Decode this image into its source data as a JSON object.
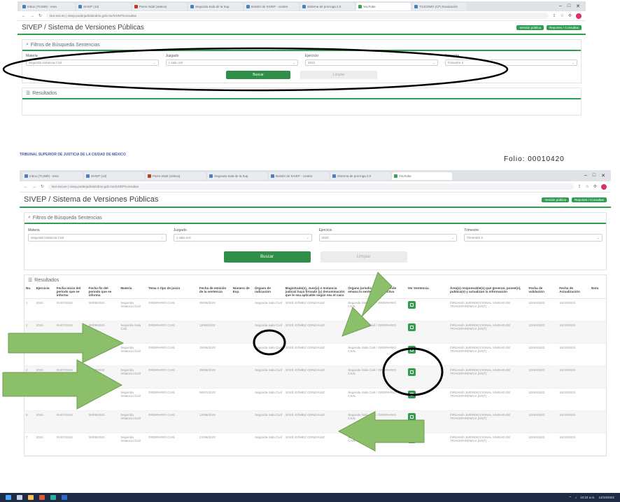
{
  "top_window": {
    "tabs": [
      {
        "label": "Inbox (70,580) - ema",
        "icon": "mail-favicon",
        "active": false
      },
      {
        "label": "SIVEP (13)",
        "icon": "doc-favicon",
        "active": false
      },
      {
        "label": "Parra Vidal (videos)",
        "icon": "youtube-favicon",
        "active": false
      },
      {
        "label": "Segunda Sala de la Sup",
        "icon": "page-favicon",
        "active": false
      },
      {
        "label": "Boletín de SIVEP - conten",
        "icon": "page-favicon",
        "active": false
      },
      {
        "label": "Sistema de prorroga 2.0",
        "icon": "page-favicon",
        "active": false
      },
      {
        "label": "YouTube",
        "icon": "chrome-favicon",
        "active": true
      },
      {
        "label": "TSJCDMX (CP) Evaluación",
        "icon": "page-favicon",
        "active": false
      }
    ],
    "url": "Not secure | sivep.poderjudicialcdmx.gob.mx/SIVEP/consultas",
    "app_title": "SIVEP / Sistema de Versiones Públicas",
    "top_buttons": [
      "Versión pública",
      "Reportes / Consultas"
    ],
    "filters_title": "Filtros de Búsqueda Sentencias",
    "filters": [
      {
        "label": "Materia",
        "value": "Segunda Instancia Civil"
      },
      {
        "label": "Juzgado",
        "value": "1 sala civil"
      },
      {
        "label": "Ejercicio",
        "value": "2022"
      },
      {
        "label": "Trimestre",
        "value": "Trimestre 3"
      }
    ],
    "search_label": "Buscar",
    "clear_label": "Limpiar",
    "results_title": "Resultados"
  },
  "footer_link": "TRIBUNAL SUPERIOR DE JUSTICIA DE LA CIUDAD DE MÉXICO",
  "cut_text": "Folio: 00010420",
  "bottom_window": {
    "tabs": [
      {
        "label": "Inbox (70,580) - ema",
        "icon": "mail-favicon",
        "active": false
      },
      {
        "label": "SIVEP (13)",
        "icon": "doc-favicon",
        "active": false
      },
      {
        "label": "Parra Vidal (videos)",
        "icon": "youtube-favicon",
        "active": false
      },
      {
        "label": "Segunda Sala de la Sup",
        "icon": "page-favicon",
        "active": false
      },
      {
        "label": "Boletín de SIVEP - conten",
        "icon": "page-favicon",
        "active": false
      },
      {
        "label": "Sistema de prorroga 2.0",
        "icon": "page-favicon",
        "active": false
      },
      {
        "label": "YouTube",
        "icon": "chrome-favicon",
        "active": true
      }
    ],
    "url": "Not secure | sivep.poderjudicialcdmx.gob.mx/SIVEP/consultas",
    "app_title": "SIVEP / Sistema de Versiones Públicas",
    "top_buttons": [
      "Versión pública",
      "Reportes / Consultas"
    ],
    "filters_title": "Filtros de Búsqueda Sentencias",
    "filters": [
      {
        "label": "Materia",
        "value": "Segunda Instancia Civil"
      },
      {
        "label": "Juzgado",
        "value": "1 sala civil"
      },
      {
        "label": "Ejercicio",
        "value": "2022"
      },
      {
        "label": "Trimestre",
        "value": "Trimestre 3"
      }
    ],
    "search_label": "Buscar",
    "clear_label": "Limpiar",
    "results_title": "Resultados",
    "table": {
      "headers": [
        "No.",
        "Ejercicio",
        "Fecha inicio del periodo que se informa",
        "Fecha fin del periodo que se informa",
        "Materia",
        "Tema o tipo de juicio",
        "Fecha de emisión de la sentencia",
        "Número de Exp.",
        "Órgano de radicación",
        "Magistrado(s), Juez(a) o Instancia judicial haya firmado (y) denominación que le sea aplicable según sea el caso",
        "Órgano jurisdiccional de donde emana la sentencia respectiva",
        "Ver Sentencia",
        "Área(s) responsable(s) que generan, posee(n), publica(n) y actualizan la información",
        "Fecha de validación",
        "Fecha de Actualización",
        "Nota"
      ],
      "rows": [
        {
          "no": "1",
          "year": "2022",
          "start": "01/07/2022",
          "end": "30/09/2022",
          "materia": "Segunda Instancia Civil",
          "tema": "ORDINARIO CIVIL",
          "fecha": "05/08/2022",
          "exp": "",
          "organo": "Segunda Sala Civil",
          "magistrado": "JOSÉ GÓMEZ GONZÁLEZ",
          "origen": "Segunda Sala Civil / ORDINARIO CIVIL",
          "area": "ÓRGANO JURISDICCIONAL UNIDAD DE TRANSPARENCIA (DGT)",
          "valid": "10/10/2022",
          "update": "10/10/2022"
        },
        {
          "no": "2",
          "year": "2022",
          "start": "01/07/2022",
          "end": "30/09/2022",
          "materia": "Segunda Sala Civil",
          "tema": "ORDINARIO CIVIL",
          "fecha": "11/08/2022",
          "exp": "",
          "organo": "Segunda Sala Civil",
          "magistrado": "JOSÉ GÓMEZ GONZÁLEZ",
          "origen": "Segunda Sala Civil / ORDINARIO CIVIL",
          "area": "ÓRGANO JURISDICCIONAL UNIDAD DE TRANSPARENCIA (DGT)",
          "valid": "10/10/2022",
          "update": "10/10/2022"
        },
        {
          "no": "3",
          "year": "2022",
          "start": "01/07/2022",
          "end": "30/09/2022",
          "materia": "Segunda Instancia Civil",
          "tema": "ORDINARIO CIVIL",
          "fecha": "15/08/2022",
          "exp": "",
          "organo": "Segunda Sala Civil",
          "magistrado": "JOSÉ GÓMEZ GONZÁLEZ",
          "origen": "Segunda Sala Civil / ORDINARIO CIVIL",
          "area": "ÓRGANO JURISDICCIONAL UNIDAD DE TRANSPARENCIA (DGT)",
          "valid": "10/10/2022",
          "update": "10/10/2022"
        },
        {
          "no": "4",
          "year": "2022",
          "start": "01/07/2022",
          "end": "30/09/2022",
          "materia": "Segunda Instancia Civil",
          "tema": "ORDINARIO CIVIL",
          "fecha": "25/08/2022",
          "exp": "",
          "organo": "Segunda Sala Civil",
          "magistrado": "JOSÉ GÓMEZ GONZÁLEZ",
          "origen": "Segunda Sala Civil / ORDINARIO CIVIL",
          "area": "ÓRGANO JURISDICCIONAL UNIDAD DE TRANSPARENCIA (DGT)",
          "valid": "10/10/2022",
          "update": "10/10/2022"
        },
        {
          "no": "5",
          "year": "2022",
          "start": "01/07/2022",
          "end": "30/09/2022",
          "materia": "Segunda Instancia Civil",
          "tema": "ORDINARIO CIVIL",
          "fecha": "06/07/2022",
          "exp": "",
          "organo": "Segunda Sala Civil",
          "magistrado": "JOSÉ GÓMEZ GONZÁLEZ",
          "origen": "Segunda Sala Civil / ORDINARIO CIVIL",
          "area": "ÓRGANO JURISDICCIONAL UNIDAD DE TRANSPARENCIA (DGT)",
          "valid": "10/10/2022",
          "update": "10/10/2022"
        },
        {
          "no": "6",
          "year": "2022",
          "start": "01/07/2022",
          "end": "30/09/2022",
          "materia": "Segunda Instancia Civil",
          "tema": "ORDINARIO CIVIL",
          "fecha": "12/09/2022",
          "exp": "",
          "organo": "Segunda Sala Civil",
          "magistrado": "JOSÉ GÓMEZ GONZÁLEZ",
          "origen": "Segunda Sala Civil / ORDINARIO CIVIL",
          "area": "ÓRGANO JURISDICCIONAL UNIDAD DE TRANSPARENCIA (DGT)",
          "valid": "10/10/2022",
          "update": "10/10/2022"
        },
        {
          "no": "7",
          "year": "2022",
          "start": "01/07/2022",
          "end": "30/09/2022",
          "materia": "Segunda Instancia Civil",
          "tema": "ORDINARIO CIVIL",
          "fecha": "21/09/2022",
          "exp": "",
          "organo": "Segunda Sala Civil",
          "magistrado": "JOSÉ GÓMEZ GONZÁLEZ",
          "origen": "Segunda Sala Civil / ORDINARIO CIVIL",
          "area": "ÓRGANO JURISDICCIONAL UNIDAD DE TRANSPARENCIA (DGT)",
          "valid": "10/10/2022",
          "update": "10/10/2022"
        }
      ]
    }
  },
  "taskbar": {
    "icons": [
      "windows-start-icon",
      "search-icon",
      "file-explorer-icon",
      "chrome-icon",
      "edge-icon",
      "word-icon"
    ],
    "tray_time": "10:22 a.m.",
    "tray_date": "12/10/2022"
  },
  "colors": {
    "accent_green": "#2f9e50",
    "arrow_green": "#8cbf6a",
    "annotation_black": "#000000",
    "taskbar": "#1f2a44"
  }
}
